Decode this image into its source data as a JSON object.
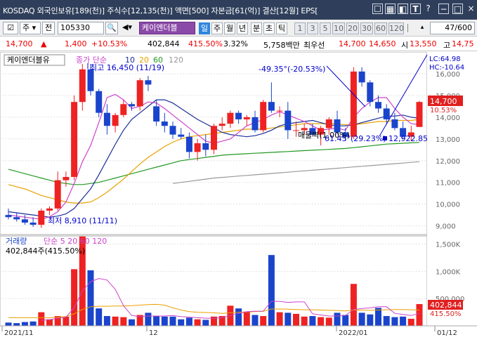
{
  "titlebar": {
    "text": "KOSDAQ 외국인보유[189(천)] 주식수[12,135(천)] 액면[500] 자본금[61(억)] 결산[12월] EPS[",
    "icons": [
      "window-list-icon",
      "chart-icon",
      "chart-toggle-icon",
      "text-icon",
      "help-icon",
      "minimize-icon",
      "maximize-icon"
    ]
  },
  "toolbar": {
    "market": "주",
    "prev_label": "전",
    "code": "105330",
    "name": "케이엔더블",
    "periods": [
      "일",
      "주",
      "월",
      "년",
      "분",
      "초",
      "틱"
    ],
    "selected_period": "일",
    "intervals": [
      "1",
      "3",
      "5",
      "10",
      "20",
      "30",
      "60",
      "120"
    ],
    "page_info": "47/600"
  },
  "quote": {
    "price": "14,700",
    "change": "1,400",
    "change_pct": "+10.53%",
    "volume": "402,844",
    "volume_ratio": "415.50%",
    "turnover": "3.32%",
    "amount": "5,758백만",
    "bid_label": "최우선",
    "bid1": "14,700",
    "bid2": "14,650",
    "open_label": "시",
    "open": "13,550",
    "high_label": "고",
    "high": "14,75"
  },
  "colors": {
    "up": "#ee2222",
    "down": "#1a44cc",
    "ma5": "#cc44cc",
    "ma10": "#1a2e99",
    "ma20": "#e8a000",
    "ma60": "#229922",
    "ma120": "#999999"
  },
  "chart_data": {
    "type": "candlestick",
    "x_labels": [
      "2021/11",
      "12",
      "2022/01",
      "01/12"
    ],
    "legend": {
      "name": "케이엔더블유",
      "ma_label": "종가 단순",
      "ma_periods": [
        "5",
        "10",
        "20",
        "60",
        "120"
      ]
    },
    "y_ticks": [
      "16,000",
      "15,000",
      "14,000",
      "13,000",
      "12,000",
      "11,000",
      "10,000",
      "9,000"
    ],
    "ylim": [
      8600,
      17000
    ],
    "annotations": {
      "high": "최고 16,450 (11/19)",
      "low": "최저 8,910 (11/11)",
      "peak_change": "-49.35°(-20.53%)",
      "trend_label": "매물벽(1.00%)",
      "from_low": "61.45°(29.23%)",
      "trend_value": "12,922.85",
      "lc": "LC:64.98",
      "hc": "HC:-10.64",
      "last_price": "14,700",
      "last_pct": "10.53%"
    },
    "candles": [
      {
        "o": 9500,
        "h": 9800,
        "l": 9300,
        "c": 9400
      },
      {
        "o": 9400,
        "h": 9600,
        "l": 9200,
        "c": 9300
      },
      {
        "o": 9300,
        "h": 9500,
        "l": 9050,
        "c": 9150
      },
      {
        "o": 9150,
        "h": 9400,
        "l": 8950,
        "c": 9050
      },
      {
        "o": 9050,
        "h": 9800,
        "l": 8910,
        "c": 9700
      },
      {
        "o": 9700,
        "h": 9900,
        "l": 9500,
        "c": 9800
      },
      {
        "o": 9800,
        "h": 11500,
        "l": 9700,
        "c": 11100
      },
      {
        "o": 11100,
        "h": 11500,
        "l": 10800,
        "c": 11250
      },
      {
        "o": 11250,
        "h": 15000,
        "l": 11100,
        "c": 14700
      },
      {
        "o": 14700,
        "h": 16450,
        "l": 14300,
        "c": 16200
      },
      {
        "o": 16200,
        "h": 16450,
        "l": 15000,
        "c": 15200
      },
      {
        "o": 15200,
        "h": 15300,
        "l": 14000,
        "c": 14200
      },
      {
        "o": 14200,
        "h": 14600,
        "l": 13200,
        "c": 13600
      },
      {
        "o": 13600,
        "h": 14200,
        "l": 13300,
        "c": 14100
      },
      {
        "o": 14100,
        "h": 14800,
        "l": 14000,
        "c": 14600
      },
      {
        "o": 14600,
        "h": 14700,
        "l": 14300,
        "c": 14500
      },
      {
        "o": 14500,
        "h": 15800,
        "l": 14300,
        "c": 15700
      },
      {
        "o": 15700,
        "h": 15900,
        "l": 15200,
        "c": 15500
      },
      {
        "o": 14500,
        "h": 14800,
        "l": 13600,
        "c": 13800
      },
      {
        "o": 13800,
        "h": 14200,
        "l": 13300,
        "c": 13600
      },
      {
        "o": 13600,
        "h": 13800,
        "l": 13000,
        "c": 13200
      },
      {
        "o": 13200,
        "h": 13500,
        "l": 13000,
        "c": 13100
      },
      {
        "o": 13100,
        "h": 13300,
        "l": 12100,
        "c": 12400
      },
      {
        "o": 12400,
        "h": 13000,
        "l": 12000,
        "c": 12800
      },
      {
        "o": 12800,
        "h": 13200,
        "l": 12200,
        "c": 12500
      },
      {
        "o": 12500,
        "h": 13700,
        "l": 12300,
        "c": 13600
      },
      {
        "o": 13600,
        "h": 14000,
        "l": 13400,
        "c": 13700
      },
      {
        "o": 13700,
        "h": 14300,
        "l": 13500,
        "c": 14200
      },
      {
        "o": 14200,
        "h": 14300,
        "l": 13700,
        "c": 13900
      },
      {
        "o": 13900,
        "h": 14100,
        "l": 13600,
        "c": 14000
      },
      {
        "o": 14000,
        "h": 14300,
        "l": 13300,
        "c": 13400
      },
      {
        "o": 13400,
        "h": 14800,
        "l": 13300,
        "c": 14700
      },
      {
        "o": 14700,
        "h": 15600,
        "l": 14200,
        "c": 14300
      },
      {
        "o": 14300,
        "h": 14500,
        "l": 14000,
        "c": 14300
      },
      {
        "o": 14300,
        "h": 14700,
        "l": 13000,
        "c": 13400
      },
      {
        "o": 13400,
        "h": 13800,
        "l": 13100,
        "c": 13400
      },
      {
        "o": 13400,
        "h": 13700,
        "l": 13200,
        "c": 13500
      },
      {
        "o": 13500,
        "h": 13700,
        "l": 13100,
        "c": 13200
      },
      {
        "o": 13200,
        "h": 13600,
        "l": 12700,
        "c": 13500
      },
      {
        "o": 13500,
        "h": 14000,
        "l": 13200,
        "c": 13900
      },
      {
        "o": 13900,
        "h": 14300,
        "l": 13200,
        "c": 13300
      },
      {
        "o": 13300,
        "h": 13500,
        "l": 12900,
        "c": 13100
      },
      {
        "o": 13100,
        "h": 16300,
        "l": 13000,
        "c": 16100
      },
      {
        "o": 16100,
        "h": 16300,
        "l": 15400,
        "c": 15600
      },
      {
        "o": 15600,
        "h": 15700,
        "l": 14500,
        "c": 14700
      },
      {
        "o": 14700,
        "h": 15000,
        "l": 14200,
        "c": 14400
      },
      {
        "o": 14400,
        "h": 14600,
        "l": 13700,
        "c": 13900
      },
      {
        "o": 13900,
        "h": 14200,
        "l": 13400,
        "c": 13500
      },
      {
        "o": 13500,
        "h": 13800,
        "l": 13000,
        "c": 13100
      },
      {
        "o": 13100,
        "h": 13600,
        "l": 12900,
        "c": 13300
      },
      {
        "o": 13550,
        "h": 14750,
        "l": 13550,
        "c": 14700
      }
    ],
    "ma5": [
      9500,
      9450,
      9400,
      9350,
      9300,
      9420,
      9650,
      10100,
      10950,
      11950,
      12700,
      13750,
      14900,
      15050,
      14800,
      14400,
      14500,
      14700,
      14650,
      14400,
      14100,
      13800,
      13500,
      13200,
      12900,
      12800,
      12900,
      13000,
      13300,
      13600,
      13750,
      13900,
      14100,
      14250,
      14100,
      13950,
      13800,
      13600,
      13400,
      13450,
      13500,
      13400,
      14000,
      14400,
      14700,
      14900,
      14900,
      14400,
      14000,
      13700,
      13650
    ],
    "ma10": [
      9650,
      9600,
      9550,
      9500,
      9450,
      9400,
      9450,
      9550,
      9800,
      10250,
      10700,
      11350,
      12050,
      12750,
      13400,
      13900,
      14200,
      14500,
      14800,
      14800,
      14650,
      14400,
      14150,
      13900,
      13700,
      13500,
      13300,
      13200,
      13150,
      13100,
      13150,
      13250,
      13400,
      13600,
      13700,
      13750,
      13800,
      13850,
      13750,
      13650,
      13600,
      13600,
      13650,
      13750,
      13850,
      13950,
      14050,
      14050,
      14100,
      14000,
      13950
    ],
    "ma20": [
      10900,
      10800,
      10700,
      10550,
      10400,
      10300,
      10200,
      10100,
      10050,
      10050,
      10100,
      10300,
      10550,
      10850,
      11150,
      11500,
      11850,
      12150,
      12400,
      12650,
      12850,
      13000,
      13100,
      13150,
      13200,
      13250,
      13300,
      13350,
      13400,
      13450,
      13450,
      13450,
      13500,
      13550,
      13600,
      13650,
      13700,
      13700,
      13700,
      13700,
      13700,
      13650,
      13650,
      13700,
      13750,
      13800,
      13800,
      13850,
      13850,
      13850,
      13900
    ],
    "ma60": [
      11600,
      11500,
      11400,
      11300,
      11200,
      11100,
      11000,
      10950,
      10900,
      10900,
      10950,
      11000,
      11100,
      11200,
      11300,
      11400,
      11500,
      11600,
      11700,
      11800,
      11900,
      12000,
      12050,
      12100,
      12150,
      12200,
      12250,
      12280,
      12300,
      12320,
      12340,
      12360,
      12380,
      12400,
      12420,
      12440,
      12460,
      12480,
      12500,
      12520,
      12540,
      12560,
      12600,
      12640,
      12680,
      12720,
      12760,
      12780,
      12800,
      12820,
      12840
    ],
    "ma120": [
      null,
      null,
      null,
      null,
      null,
      null,
      null,
      null,
      null,
      null,
      null,
      null,
      null,
      null,
      null,
      null,
      null,
      null,
      null,
      null,
      10950,
      11000,
      11050,
      11100,
      11150,
      11200,
      11230,
      11260,
      11290,
      11320,
      11350,
      11380,
      11410,
      11440,
      11470,
      11500,
      11530,
      11560,
      11590,
      11620,
      11650,
      11680,
      11710,
      11740,
      11770,
      11800,
      11830,
      11860,
      11890,
      11920,
      11950
    ],
    "volume_panel": {
      "title": "거래량",
      "ma_label": "단순 5 20 60 120",
      "current": "402,844주(415.50%)",
      "y_ticks": [
        "1,500K",
        "1,000K",
        "500,000"
      ],
      "ylim": [
        0,
        1650000
      ],
      "last_value": "402,844",
      "last_pct": "415.50%",
      "volumes": [
        60000,
        50000,
        70000,
        80000,
        250000,
        120000,
        180000,
        170000,
        1040000,
        1640000,
        1020000,
        320000,
        180000,
        170000,
        160000,
        120000,
        200000,
        240000,
        180000,
        170000,
        170000,
        120000,
        150000,
        120000,
        110000,
        170000,
        180000,
        370000,
        320000,
        260000,
        200000,
        180000,
        1300000,
        250000,
        240000,
        220000,
        170000,
        180000,
        160000,
        150000,
        240000,
        200000,
        770000,
        240000,
        210000,
        330000,
        180000,
        160000,
        170000,
        130000,
        400000
      ],
      "vma5": [
        null,
        null,
        null,
        null,
        102000,
        114000,
        140000,
        160000,
        332000,
        642000,
        810000,
        870000,
        840000,
        670000,
        370000,
        190000,
        170000,
        180000,
        180000,
        180000,
        190000,
        170000,
        160000,
        150000,
        140000,
        140000,
        150000,
        190000,
        230000,
        260000,
        270000,
        270000,
        450000,
        450000,
        430000,
        440000,
        440000,
        220000,
        200000,
        180000,
        180000,
        190000,
        300000,
        320000,
        330000,
        350000,
        350000,
        230000,
        210000,
        190000,
        230000
      ],
      "vma20": [
        150000,
        150000,
        150000,
        150000,
        150000,
        150000,
        160000,
        170000,
        220000,
        300000,
        350000,
        360000,
        360000,
        365000,
        365000,
        370000,
        380000,
        390000,
        395000,
        380000,
        330000,
        290000,
        260000,
        250000,
        245000,
        240000,
        230000,
        240000,
        250000,
        255000,
        260000,
        265000,
        310000,
        310000,
        305000,
        300000,
        295000,
        295000,
        290000,
        285000,
        280000,
        275000,
        290000,
        290000,
        285000,
        290000,
        295000,
        300000,
        300000,
        295000,
        290000
      ]
    }
  }
}
